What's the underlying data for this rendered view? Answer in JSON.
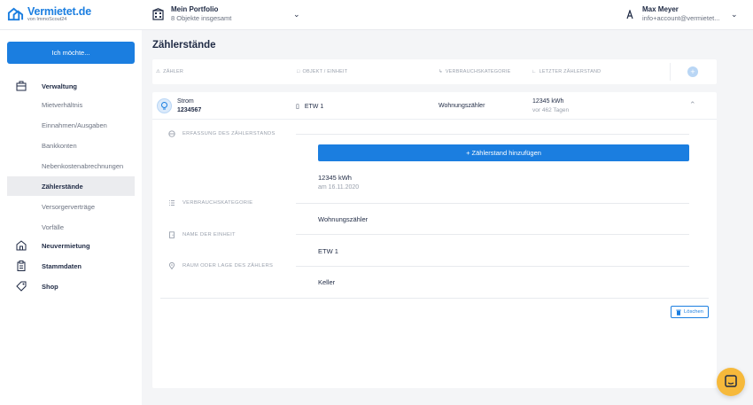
{
  "brand": {
    "name": "Vermietet.de",
    "sub": "von ImmoScout24"
  },
  "portfolio": {
    "title": "Mein Portfolio",
    "subtitle": "8 Objekte insgesamt"
  },
  "user": {
    "name": "Max Meyer",
    "email": "info+account@vermietet..."
  },
  "sidebar": {
    "cta_label": "Ich möchte...",
    "sections": [
      {
        "label": "Verwaltung",
        "icon": "building-icon"
      },
      {
        "label": "Neuvermietung",
        "icon": "house-icon"
      },
      {
        "label": "Stammdaten",
        "icon": "clipboard-icon"
      },
      {
        "label": "Shop",
        "icon": "tag-icon"
      }
    ],
    "items": [
      "Mietverhältnis",
      "Einnahmen/Ausgaben",
      "Bankkonten",
      "Nebenkostenabrechnungen",
      "Zählerstände",
      "Versorgerverträge",
      "Vorfälle"
    ],
    "active_item": "Zählerstände"
  },
  "page": {
    "title": "Zählerstände"
  },
  "table": {
    "columns": [
      "ZÄHLER",
      "OBJEKT / EINHEIT",
      "VERBRAUCHSKATEGORIE",
      "LETZTER ZÄHLERSTAND"
    ],
    "row": {
      "type": "Strom",
      "number": "1234567",
      "unit": "ETW 1",
      "category": "Wohnungszähler",
      "last_reading": "12345 kWh",
      "last_reading_age": "vor 462 Tagen"
    }
  },
  "detail": {
    "sections": {
      "erfassung": "ERFASSUNG DES ZÄHLERSTANDS",
      "kategorie": "VERBRAUCHSKATEGORIE",
      "einheit": "NAME DER EINHEIT",
      "raum": "RAUM ODER LAGE DES ZÄHLERS"
    },
    "add_button": "+  Zählerstand hinzufügen",
    "reading_value": "12345 kWh",
    "reading_date": "am 16.11.2020",
    "category_value": "Wohnungszähler",
    "unit_value": "ETW 1",
    "location_value": "Keller",
    "delete_button": "Löschen"
  },
  "colors": {
    "primary": "#1b7ee0",
    "chat": "#f6b93b",
    "background": "#f4f5f7"
  }
}
